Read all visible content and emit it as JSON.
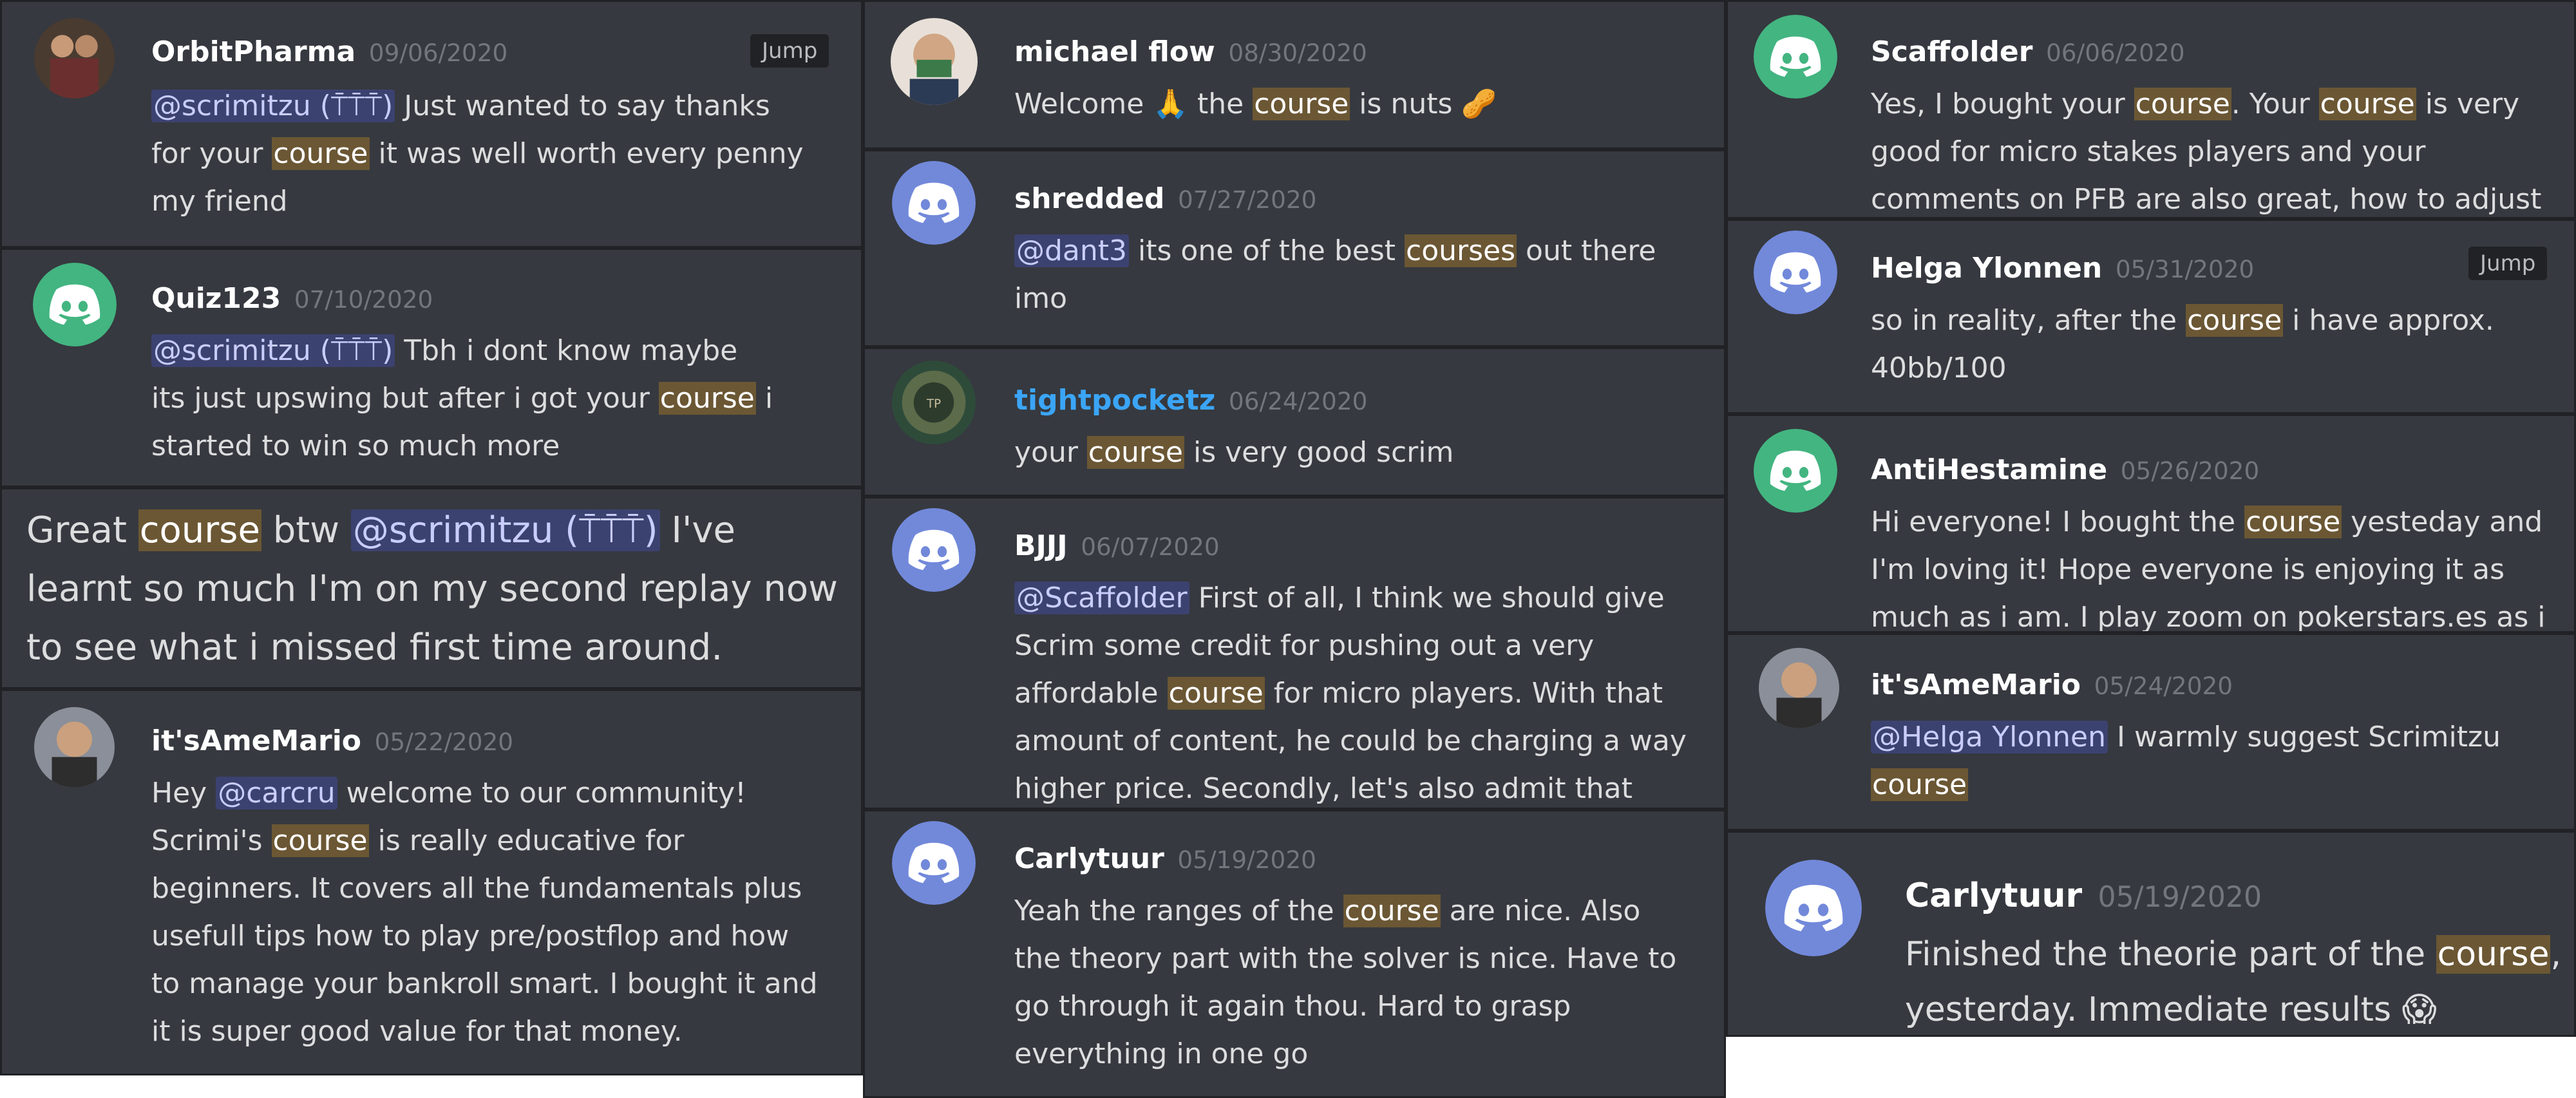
{
  "colors": {
    "card_bg": "#36393f",
    "highlight": "#6b5734",
    "mention_bg": "#3c4270",
    "discord_blurple": "#7289da",
    "discord_green": "#43b581"
  },
  "jump_label": "Jump",
  "messages": [
    {
      "name": "OrbitPharma",
      "date": "09/06/2020",
      "avatar": "photo-avatar",
      "parts": [
        {
          "m": "@scrimitzu (⍑⍑⍑)"
        },
        {
          "t": " Just wanted to say thanks\nfor your "
        },
        {
          "h": "course"
        },
        {
          "t": " it was well worth every penny\nmy friend"
        }
      ]
    },
    {
      "name": "Quiz123",
      "date": "07/10/2020",
      "avatar": "discord-green-icon",
      "parts": [
        {
          "m": "@scrimitzu (⍑⍑⍑)"
        },
        {
          "t": " Tbh i dont know maybe\nits just upswing but after i got your "
        },
        {
          "h": "course"
        },
        {
          "t": " i\nstarted to win so much more"
        }
      ]
    },
    {
      "name": "",
      "date": "",
      "avatar": "",
      "parts": [
        {
          "t": "Great "
        },
        {
          "h": "course"
        },
        {
          "t": " btw "
        },
        {
          "m": "@scrimitzu (⍑⍑⍑)"
        },
        {
          "t": " I've\nlearnt so much I'm on my second replay now\nto see what i missed first time around."
        }
      ]
    },
    {
      "name": "it'sAmeMario",
      "date": "05/22/2020",
      "avatar": "photo-avatar",
      "parts": [
        {
          "t": "Hey "
        },
        {
          "m": "@carcru"
        },
        {
          "t": " welcome to our community!\nScrimi's "
        },
        {
          "h": "course"
        },
        {
          "t": " is really educative for\nbeginners. It covers all the fundamentals plus\nusefull tips how to play pre/postflop and how\nto manage your bankroll smart. I bought it and\nit is super good value for that money."
        }
      ]
    },
    {
      "name": "michael flow",
      "date": "08/30/2020",
      "avatar": "photo-avatar",
      "parts": [
        {
          "t": "Welcome 🙏 the "
        },
        {
          "h": "course"
        },
        {
          "t": " is nuts 🥜"
        }
      ]
    },
    {
      "name": "shredded",
      "date": "07/27/2020",
      "avatar": "discord-blurple-icon",
      "parts": [
        {
          "m": "@dant3"
        },
        {
          "t": " its one of the best "
        },
        {
          "h": "courses"
        },
        {
          "t": " out there\nimo"
        }
      ]
    },
    {
      "name": "tightpocketz",
      "date": "06/24/2020",
      "avatar": "photo-avatar",
      "parts": [
        {
          "t": "your "
        },
        {
          "h": "course"
        },
        {
          "t": " is very good scrim"
        }
      ]
    },
    {
      "name": "BJJJ",
      "date": "06/07/2020",
      "avatar": "discord-blurple-icon",
      "parts": [
        {
          "m": "@Scaffolder"
        },
        {
          "t": " First of all, I think we should give\nScrim some credit for pushing out a very\naffordable "
        },
        {
          "h": "course"
        },
        {
          "t": " for micro players. With that\namount of content, he could be charging a way\nhigher price. Secondly, let's also admit that"
        }
      ]
    },
    {
      "name": "Carlytuur",
      "date": "05/19/2020",
      "avatar": "discord-blurple-icon",
      "parts": [
        {
          "t": "Yeah the ranges of the "
        },
        {
          "h": "course"
        },
        {
          "t": " are nice.  Also\nthe theory part with the solver is nice. Have to\ngo through it again thou. Hard to grasp\neverything in one go"
        }
      ]
    },
    {
      "name": "Scaffolder",
      "date": "06/06/2020",
      "avatar": "discord-green-icon",
      "parts": [
        {
          "t": "Yes, I bought your "
        },
        {
          "h": "course"
        },
        {
          "t": ". Your "
        },
        {
          "h": "course"
        },
        {
          "t": " is very\ngood for micro stakes players and your\ncomments on PFB are also great, how to adjust"
        }
      ]
    },
    {
      "name": "Helga Ylonnen",
      "date": "05/31/2020",
      "avatar": "discord-blurple-icon",
      "parts": [
        {
          "t": "so in reality, after the "
        },
        {
          "h": "course"
        },
        {
          "t": " i have approx.\n40bb/100"
        }
      ]
    },
    {
      "name": "AntiHestamine",
      "date": "05/26/2020",
      "avatar": "discord-green-icon",
      "parts": [
        {
          "t": "Hi everyone! I bought the "
        },
        {
          "h": "course"
        },
        {
          "t": " yesteday and\nI'm loving it! Hope everyone is enjoying it as\nmuch as i am. I play zoom on pokerstars.es as i"
        }
      ]
    },
    {
      "name": "it'sAmeMario",
      "date": "05/24/2020",
      "avatar": "photo-avatar",
      "parts": [
        {
          "m": "@Helga Ylonnen"
        },
        {
          "t": " I warmly suggest Scrimitzu\n"
        },
        {
          "h": "course"
        }
      ]
    },
    {
      "name": "Carlytuur",
      "date": "05/19/2020",
      "avatar": "discord-blurple-icon",
      "parts": [
        {
          "t": "Finished the theorie part of the "
        },
        {
          "h": "course"
        },
        {
          "t": ",\nyesterday. Immediate results 😱"
        }
      ]
    }
  ]
}
